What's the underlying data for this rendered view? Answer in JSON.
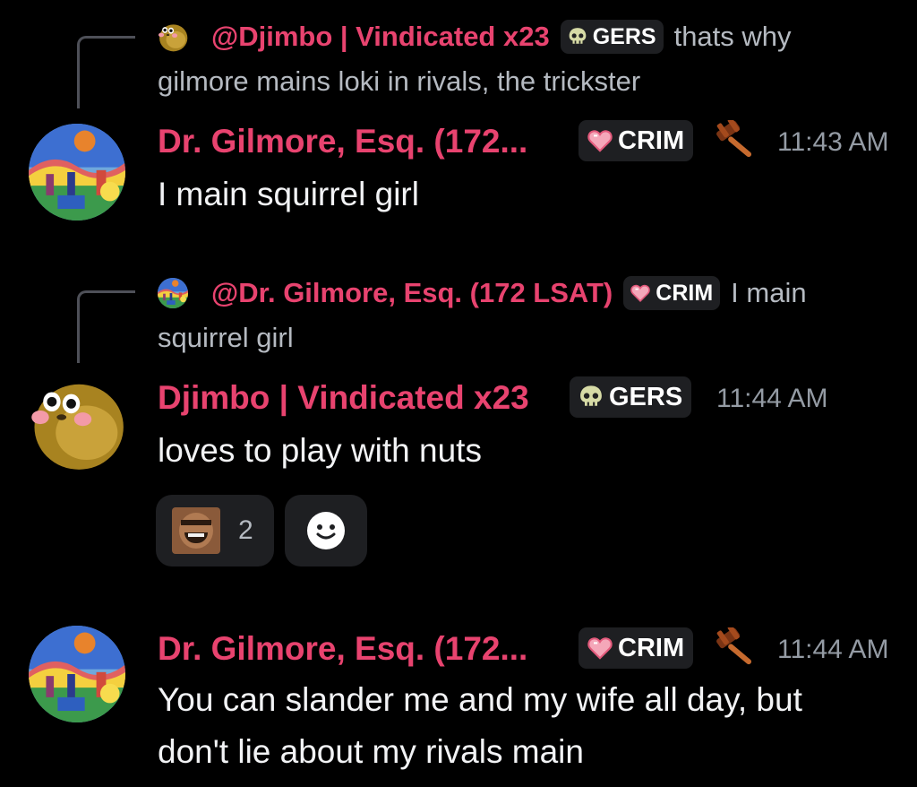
{
  "messages": [
    {
      "reply": {
        "author": "@Djimbo | Vindicated x23",
        "tag": "GERS",
        "text_line1": "thats why",
        "text_line2": "gilmore mains loki in rivals, the trickster"
      },
      "author": "Dr. Gilmore, Esq. (172...",
      "tag": "CRIM",
      "time": "11:43 AM",
      "text": "I main squirrel girl"
    },
    {
      "reply": {
        "author": "@Dr. Gilmore, Esq. (172 LSAT)",
        "tag": "CRIM",
        "text_line1": "I main",
        "text_line2": "squirrel girl"
      },
      "author": "Djimbo | Vindicated x23",
      "tag": "GERS",
      "time": "11:44 AM",
      "text": "loves to play with nuts",
      "reactions": [
        {
          "emoji": "laughing-man-emoji",
          "count": "2"
        }
      ]
    },
    {
      "author": "Dr. Gilmore, Esq. (172...",
      "tag": "CRIM",
      "time": "11:44 AM",
      "text_line1": "You can slander me and my wife all day, but",
      "text_line2": "don't lie about my rivals main"
    }
  ],
  "colors": {
    "background": "#000000",
    "username": "#e8436f",
    "tag_bg": "#1e1f22",
    "timestamp": "#949ba4",
    "message_text": "#f2f3f5"
  }
}
